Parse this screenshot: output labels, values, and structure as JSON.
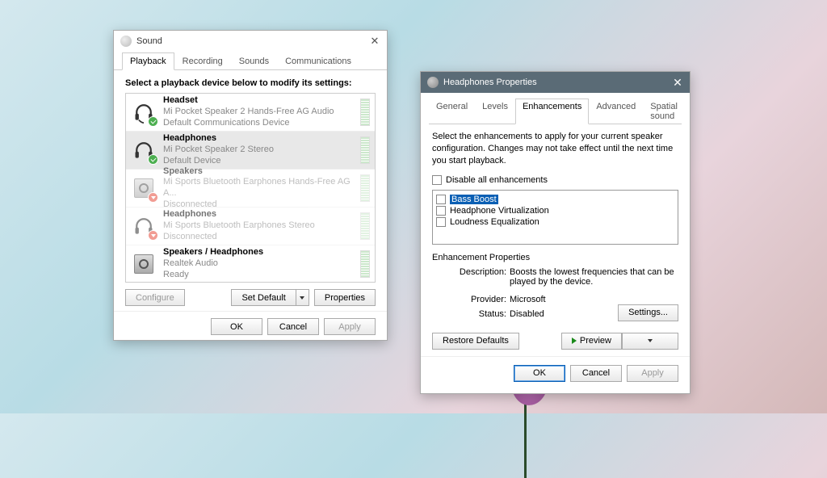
{
  "sound": {
    "title": "Sound",
    "tabs": [
      "Playback",
      "Recording",
      "Sounds",
      "Communications"
    ],
    "active_tab": 0,
    "instruction": "Select a playback device below to modify its settings:",
    "devices": [
      {
        "name": "Headset",
        "sub": "Mi Pocket Speaker 2 Hands-Free AG Audio",
        "status": "Default Communications Device",
        "badge": "green",
        "icon": "headset"
      },
      {
        "name": "Headphones",
        "sub": "Mi Pocket Speaker 2 Stereo",
        "status": "Default Device",
        "badge": "green",
        "icon": "headphones",
        "selected": true
      },
      {
        "name": "Speakers",
        "sub": "Mi Sports Bluetooth Earphones Hands-Free AG A...",
        "status": "Disconnected",
        "badge": "red",
        "icon": "speaker",
        "disabled": true
      },
      {
        "name": "Headphones",
        "sub": "Mi Sports Bluetooth Earphones Stereo",
        "status": "Disconnected",
        "badge": "red",
        "icon": "headphones",
        "disabled": true
      },
      {
        "name": "Speakers / Headphones",
        "sub": "Realtek Audio",
        "status": "Ready",
        "badge": "none",
        "icon": "speaker"
      }
    ],
    "buttons": {
      "configure": "Configure",
      "set_default": "Set Default",
      "properties": "Properties",
      "ok": "OK",
      "cancel": "Cancel",
      "apply": "Apply"
    }
  },
  "props": {
    "title": "Headphones Properties",
    "tabs": [
      "General",
      "Levels",
      "Enhancements",
      "Advanced",
      "Spatial sound"
    ],
    "active_tab": 2,
    "description": "Select the enhancements to apply for your current speaker configuration. Changes may not take effect until the next time you start playback.",
    "disable_all": "Disable all enhancements",
    "enhancements": [
      {
        "label": "Bass Boost",
        "selected": true
      },
      {
        "label": "Headphone Virtualization"
      },
      {
        "label": "Loudness Equalization"
      }
    ],
    "properties_heading": "Enhancement Properties",
    "desc_label": "Description:",
    "desc_value": "Boosts the lowest frequencies that can be played by the device.",
    "provider_label": "Provider:",
    "provider_value": "Microsoft",
    "status_label": "Status:",
    "status_value": "Disabled",
    "settings_btn": "Settings...",
    "restore_btn": "Restore Defaults",
    "preview_btn": "Preview",
    "ok": "OK",
    "cancel": "Cancel",
    "apply": "Apply"
  }
}
